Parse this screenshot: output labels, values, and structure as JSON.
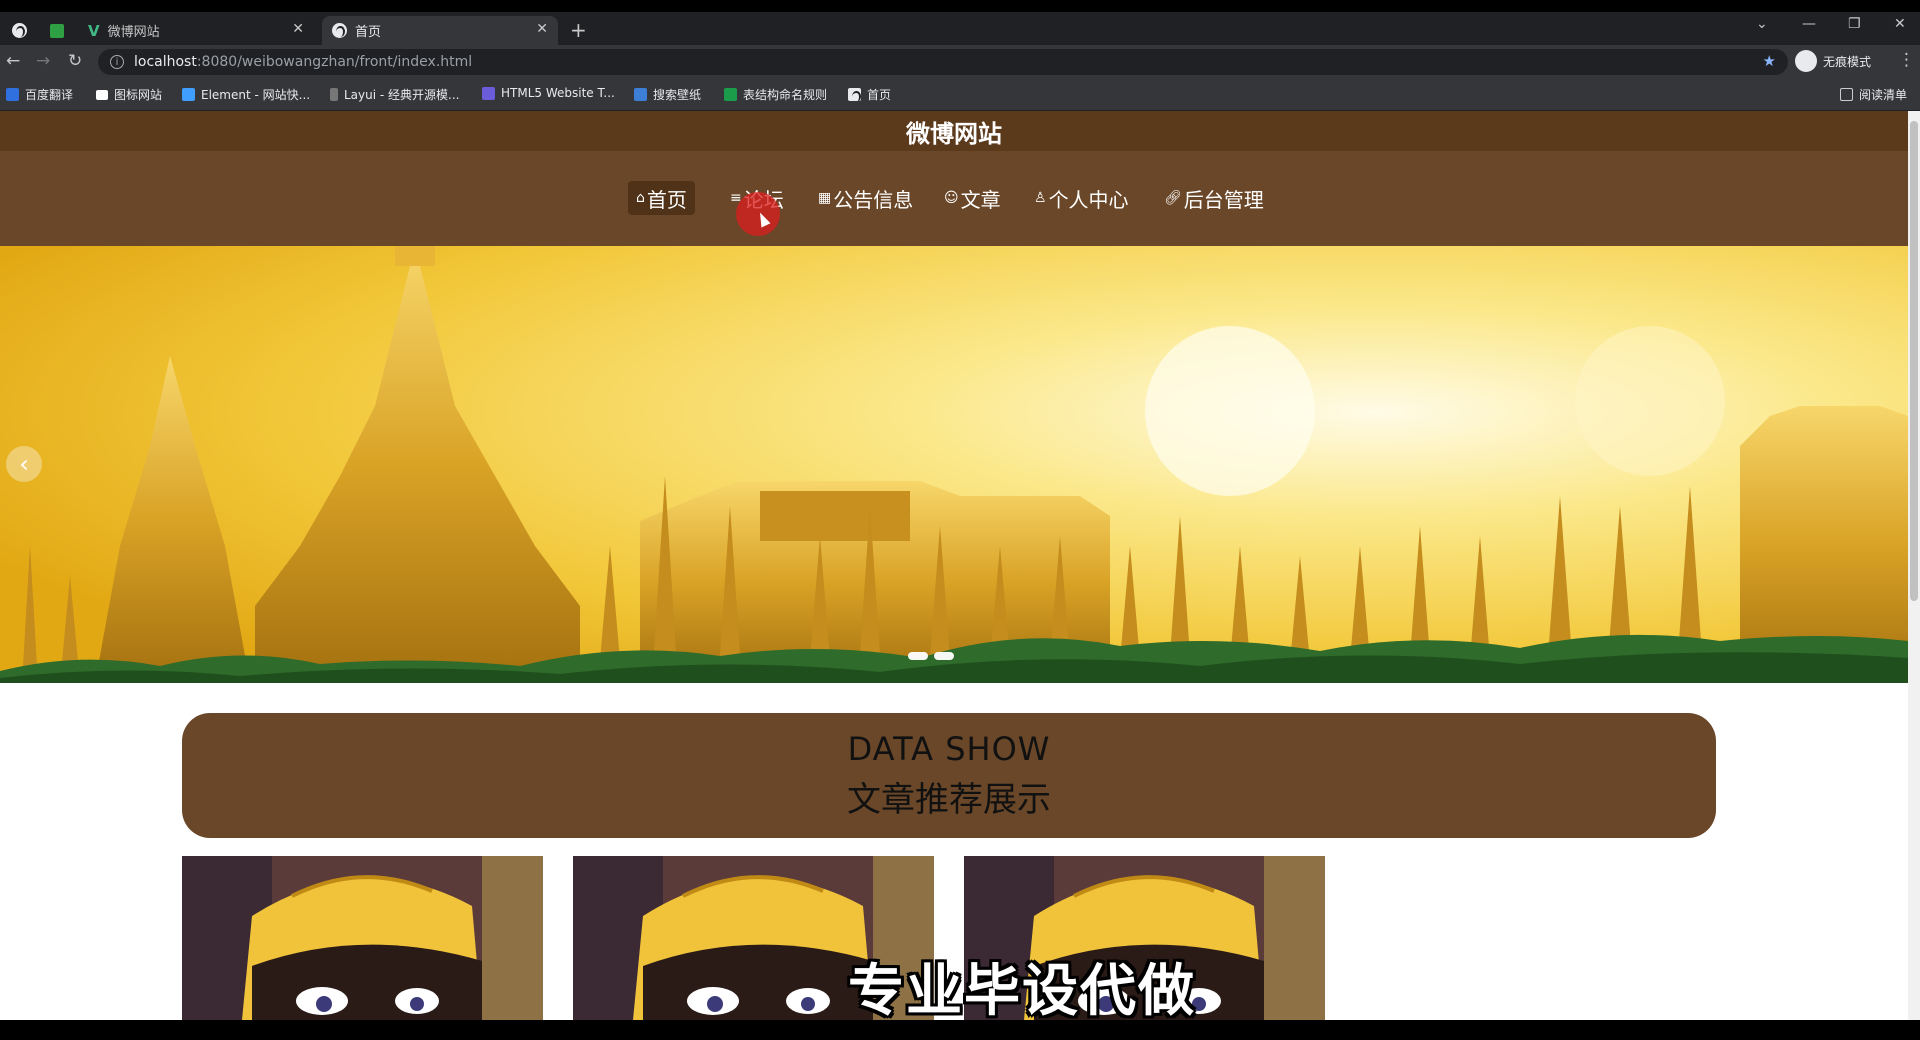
{
  "browser": {
    "tabs": [
      {
        "title": "微博网站",
        "active": false
      },
      {
        "title": "首页",
        "active": true
      }
    ],
    "url_host": "localhost",
    "url_path": ":8080/weibowangzhan/front/index.html",
    "profile_label": "无痕模式",
    "bookmarks": [
      "百度翻译",
      "图标网站",
      "Element - 网站快...",
      "Layui - 经典开源模...",
      "HTML5 Website T...",
      "搜索壁纸",
      "表结构命名规则",
      "首页"
    ],
    "reading_list": "阅读清单"
  },
  "site": {
    "title": "微博网站",
    "nav": [
      {
        "label": "首页",
        "icon": "home-icon",
        "active": true
      },
      {
        "label": "论坛",
        "icon": "list-icon",
        "active": false
      },
      {
        "label": "公告信息",
        "icon": "notice-icon",
        "active": false
      },
      {
        "label": "文章",
        "icon": "article-icon",
        "active": false
      },
      {
        "label": "个人中心",
        "icon": "user-icon",
        "active": false
      },
      {
        "label": "后台管理",
        "icon": "link-icon",
        "active": false
      }
    ]
  },
  "section": {
    "title_en": "DATA SHOW",
    "title_cn": "文章推荐展示"
  },
  "watermark": "专业毕设代做",
  "colors": {
    "title_bar": "#5b3a1c",
    "nav_bar": "#6a4728",
    "nav_active": "#4f3218"
  }
}
